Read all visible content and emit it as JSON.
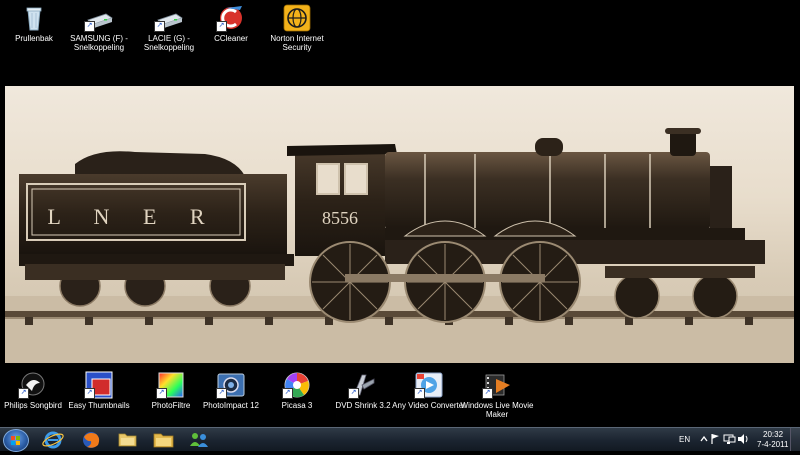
{
  "desktop": {
    "top_icons": [
      {
        "label": "Prullenbak",
        "icon": "recycle-bin-icon"
      },
      {
        "label": "SAMSUNG (F) - Snelkoppeling",
        "icon": "drive-icon"
      },
      {
        "label": "LACIE (G) - Snelkoppeling",
        "icon": "drive-icon"
      },
      {
        "label": "CCleaner",
        "icon": "ccleaner-icon"
      },
      {
        "label": "Norton Internet Security",
        "icon": "norton-icon"
      }
    ],
    "bottom_icons": [
      {
        "label": "Philips Songbird",
        "icon": "songbird-icon"
      },
      {
        "label": "Easy Thumbnails",
        "icon": "easy-thumbnails-icon"
      },
      {
        "label": "PhotoFiltre",
        "icon": "photofiltre-icon"
      },
      {
        "label": "PhotoImpact 12",
        "icon": "photoimpact-icon"
      },
      {
        "label": "Picasa 3",
        "icon": "picasa-icon"
      },
      {
        "label": "DVD Shrink 3.2",
        "icon": "dvd-shrink-icon"
      },
      {
        "label": "Any Video Converter",
        "icon": "video-converter-icon"
      },
      {
        "label": "Windows Live Movie Maker",
        "icon": "movie-maker-icon"
      }
    ],
    "wallpaper": {
      "tender_text": "L N E R",
      "engine_number": "8556"
    }
  },
  "taskbar": {
    "pinned": [
      "internet-explorer-icon",
      "firefox-icon",
      "folder-icon",
      "explorer-icon",
      "messenger-icon"
    ],
    "language": "EN",
    "clock_time": "20:32",
    "clock_date": "7-4-2011"
  }
}
